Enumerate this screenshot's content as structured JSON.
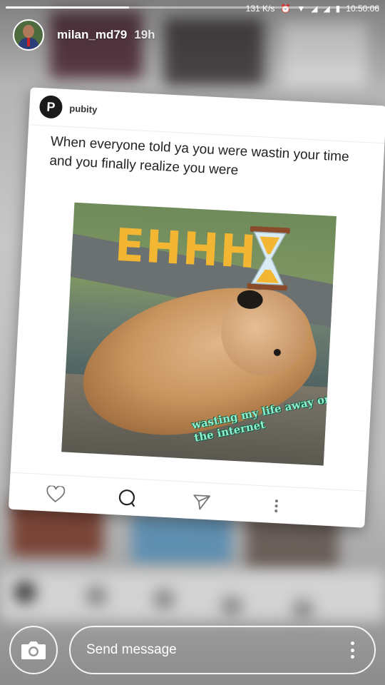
{
  "status_bar": {
    "speed": "131 K/s",
    "time": "10:50:06"
  },
  "story": {
    "progress": 0.33,
    "username": "milan_md79",
    "posted_ago": "19h"
  },
  "post": {
    "account": "pubity",
    "logo_letter": "P",
    "caption": "When everyone told ya you were wastin your time and you finally realize you were",
    "meme_top_text": "EHHH",
    "meme_overlay_text": "wasting my life away on the internet"
  },
  "reply": {
    "placeholder": "Send message"
  },
  "icons": {
    "camera": "camera-icon",
    "like": "heart-icon",
    "comment": "comment-icon",
    "share": "send-icon",
    "more": "more-vertical-icon",
    "hourglass": "hourglass-icon"
  },
  "colors": {
    "meme_text": "#f2b632",
    "overlay_text": "#8ef0d0"
  }
}
